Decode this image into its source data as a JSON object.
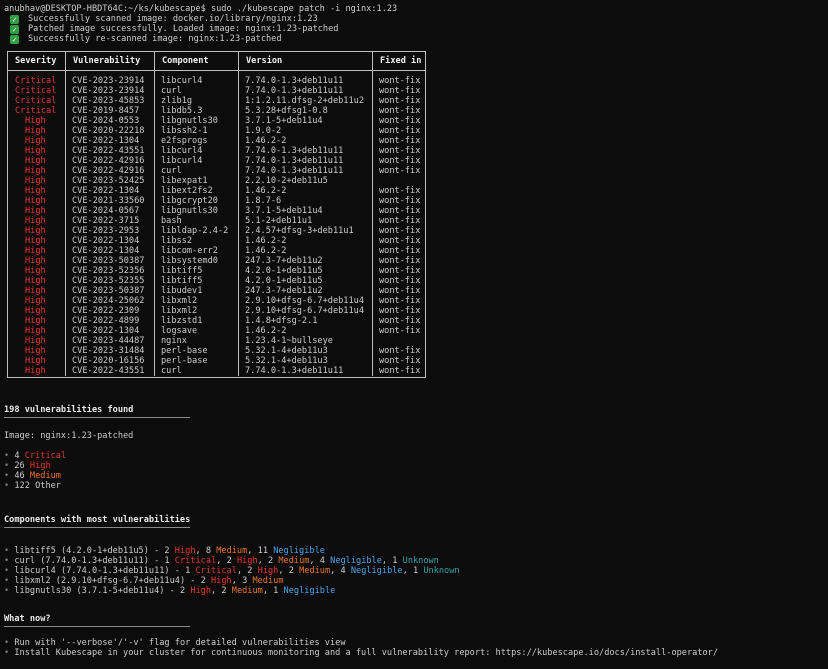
{
  "prompt": "anubhav@DESKTOP-HBDT64C:~/ks/kubescape$ sudo ./kubescape patch -i nginx:1.23",
  "status_lines": [
    "Successfully scanned image: docker.io/library/nginx:1.23",
    "Patched image successfully. Loaded image: nginx:1.23-patched",
    "Successfully re-scanned image: nginx:1.23-patched"
  ],
  "check_glyph": "✓",
  "table": {
    "headers": [
      "Severity",
      "Vulnerability",
      "Component",
      "Version",
      "Fixed in"
    ],
    "rows": [
      [
        "Critical",
        "CVE-2023-23914",
        "libcurl4",
        "7.74.0-1.3+deb11u11",
        "wont-fix"
      ],
      [
        "Critical",
        "CVE-2023-23914",
        "curl",
        "7.74.0-1.3+deb11u11",
        "wont-fix"
      ],
      [
        "Critical",
        "CVE-2023-45853",
        "zlib1g",
        "1:1.2.11.dfsg-2+deb11u2",
        "wont-fix"
      ],
      [
        "Critical",
        "CVE-2019-8457",
        "libdb5.3",
        "5.3.28+dfsg1-0.8",
        "wont-fix"
      ],
      [
        "High",
        "CVE-2024-0553",
        "libgnutls30",
        "3.7.1-5+deb11u4",
        "wont-fix"
      ],
      [
        "High",
        "CVE-2020-22218",
        "libssh2-1",
        "1.9.0-2",
        "wont-fix"
      ],
      [
        "High",
        "CVE-2022-1304",
        "e2fsprogs",
        "1.46.2-2",
        "wont-fix"
      ],
      [
        "High",
        "CVE-2022-43551",
        "libcurl4",
        "7.74.0-1.3+deb11u11",
        "wont-fix"
      ],
      [
        "High",
        "CVE-2022-42916",
        "libcurl4",
        "7.74.0-1.3+deb11u11",
        "wont-fix"
      ],
      [
        "High",
        "CVE-2022-42916",
        "curl",
        "7.74.0-1.3+deb11u11",
        "wont-fix"
      ],
      [
        "High",
        "CVE-2023-52425",
        "libexpat1",
        "2.2.10-2+deb11u5",
        ""
      ],
      [
        "High",
        "CVE-2022-1304",
        "libext2fs2",
        "1.46.2-2",
        "wont-fix"
      ],
      [
        "High",
        "CVE-2021-33560",
        "libgcrypt20",
        "1.8.7-6",
        "wont-fix"
      ],
      [
        "High",
        "CVE-2024-0567",
        "libgnutls30",
        "3.7.1-5+deb11u4",
        "wont-fix"
      ],
      [
        "High",
        "CVE-2022-3715",
        "bash",
        "5.1-2+deb11u1",
        "wont-fix"
      ],
      [
        "High",
        "CVE-2023-2953",
        "libldap-2.4-2",
        "2.4.57+dfsg-3+deb11u1",
        "wont-fix"
      ],
      [
        "High",
        "CVE-2022-1304",
        "libss2",
        "1.46.2-2",
        "wont-fix"
      ],
      [
        "High",
        "CVE-2022-1304",
        "libcom-err2",
        "1.46.2-2",
        "wont-fix"
      ],
      [
        "High",
        "CVE-2023-50387",
        "libsystemd0",
        "247.3-7+deb11u2",
        "wont-fix"
      ],
      [
        "High",
        "CVE-2023-52356",
        "libtiff5",
        "4.2.0-1+deb11u5",
        "wont-fix"
      ],
      [
        "High",
        "CVE-2023-52355",
        "libtiff5",
        "4.2.0-1+deb11u5",
        "wont-fix"
      ],
      [
        "High",
        "CVE-2023-50387",
        "libudev1",
        "247.3-7+deb11u2",
        "wont-fix"
      ],
      [
        "High",
        "CVE-2024-25062",
        "libxml2",
        "2.9.10+dfsg-6.7+deb11u4",
        "wont-fix"
      ],
      [
        "High",
        "CVE-2022-2309",
        "libxml2",
        "2.9.10+dfsg-6.7+deb11u4",
        "wont-fix"
      ],
      [
        "High",
        "CVE-2022-4899",
        "libzstd1",
        "1.4.8+dfsg-2.1",
        "wont-fix"
      ],
      [
        "High",
        "CVE-2022-1304",
        "logsave",
        "1.46.2-2",
        "wont-fix"
      ],
      [
        "High",
        "CVE-2023-44487",
        "nginx",
        "1.23.4-1~bullseye",
        ""
      ],
      [
        "High",
        "CVE-2023-31484",
        "perl-base",
        "5.32.1-4+deb11u3",
        "wont-fix"
      ],
      [
        "High",
        "CVE-2020-16156",
        "perl-base",
        "5.32.1-4+deb11u3",
        "wont-fix"
      ],
      [
        "High",
        "CVE-2022-43551",
        "curl",
        "7.74.0-1.3+deb11u11",
        "wont-fix"
      ]
    ]
  },
  "summary": {
    "title": "198 vulnerabilities found",
    "image_line": "Image: nginx:1.23-patched",
    "counts": [
      {
        "num": "4",
        "label": "Critical",
        "cls": "crit"
      },
      {
        "num": "26",
        "label": "High",
        "cls": "high"
      },
      {
        "num": "46",
        "label": "Medium",
        "cls": "med"
      },
      {
        "num": "122",
        "label": "Other",
        "cls": ""
      }
    ]
  },
  "components": {
    "title": "Components with most vulnerabilities",
    "items": [
      {
        "name": "libtiff5 (4.2.0-1+deb11u5) - ",
        "parts": [
          [
            "2",
            "High",
            "high"
          ],
          [
            "8",
            "Medium",
            "med"
          ],
          [
            "11",
            "Negligible",
            "negl"
          ]
        ]
      },
      {
        "name": "curl (7.74.0-1.3+deb11u11) - ",
        "parts": [
          [
            "1",
            "Critical",
            "crit"
          ],
          [
            "2",
            "High",
            "high"
          ],
          [
            "2",
            "Medium",
            "med"
          ],
          [
            "4",
            "Negligible",
            "negl"
          ],
          [
            "1",
            "Unknown",
            "unk"
          ]
        ]
      },
      {
        "name": "libcurl4 (7.74.0-1.3+deb11u11) - ",
        "parts": [
          [
            "1",
            "Critical",
            "crit"
          ],
          [
            "2",
            "High",
            "high"
          ],
          [
            "2",
            "Medium",
            "med"
          ],
          [
            "4",
            "Negligible",
            "negl"
          ],
          [
            "1",
            "Unknown",
            "unk"
          ]
        ]
      },
      {
        "name": "libxml2 (2.9.10+dfsg-6.7+deb11u4) - ",
        "parts": [
          [
            "2",
            "High",
            "high"
          ],
          [
            "3",
            "Medium",
            "med"
          ]
        ]
      },
      {
        "name": "libgnutls30 (3.7.1-5+deb11u4) - ",
        "parts": [
          [
            "2",
            "High",
            "high"
          ],
          [
            "2",
            "Medium",
            "med"
          ],
          [
            "1",
            "Negligible",
            "negl"
          ]
        ]
      }
    ]
  },
  "whatnow": {
    "title": "What now?",
    "items": [
      "Run with '--verbose'/'-v' flag for detailed vulnerabilities view",
      "Install Kubescape in your cluster for continuous monitoring and a full vulnerability report: https://kubescape.io/docs/install-operator/"
    ]
  },
  "colors": {
    "background": "#0c0c0c",
    "critical": "#d7373b",
    "high": "#e8352d",
    "medium": "#e8742d",
    "negligible": "#4aa3e8",
    "unknown": "#3aa0a8",
    "success": "#2ea043"
  },
  "bullet": "•"
}
